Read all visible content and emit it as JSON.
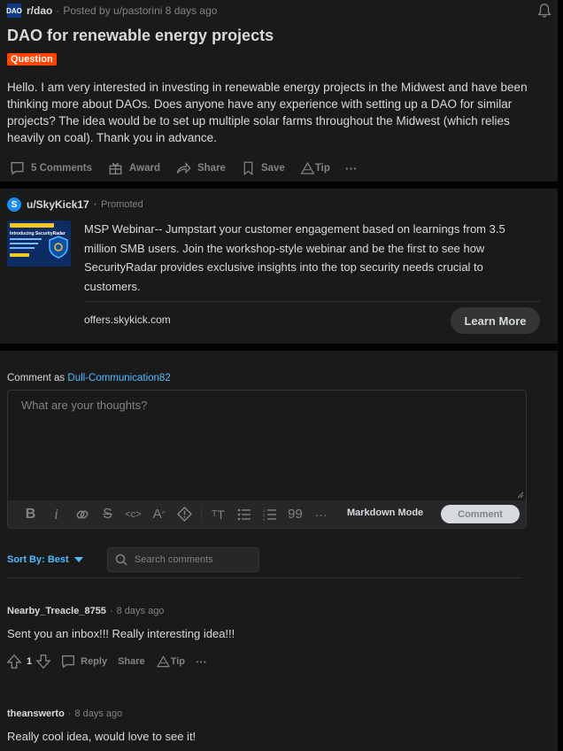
{
  "post": {
    "subreddit": "r/dao",
    "sub_icon_text": "DAO",
    "posted_by": "Posted by u/pastorini 8 days ago",
    "title": "DAO for renewable energy projects",
    "flair": "Question",
    "body": "Hello. I am very interested in investing in renewable energy projects in the Midwest and have been thinking more about DAOs. Does anyone have any experience with setting up a DAO for similar projects? The idea would be to set up multiple solar farms throughout the Midwest (which relies heavily on coal). Thank you in advance.",
    "actions": {
      "comments": "5 Comments",
      "award": "Award",
      "share": "Share",
      "save": "Save",
      "tip": "Tip",
      "more": "···"
    }
  },
  "promo": {
    "user": "u/SkyKick17",
    "icon_letter": "S",
    "label": "Promoted",
    "thumb_title": "Introducing SecurityRadar",
    "text": "MSP Webinar-- Jumpstart your customer engagement based on learnings from 3.5 million SMB users. Join the workshop-style webinar and be the first to see how SecurityRadar provides exclusive insights into the top security needs crucial to customers.",
    "link": "offers.skykick.com",
    "button": "Learn More"
  },
  "composer": {
    "comment_as_prefix": "Comment as",
    "username": "Dull-Communication82",
    "placeholder": "What are your thoughts?",
    "markdown_mode": "Markdown Mode",
    "comment_button": "Comment",
    "toolbar_icons": [
      "bold-icon",
      "italic-icon",
      "link-icon",
      "strikethrough-icon",
      "inline-code-icon",
      "superscript-icon",
      "spoiler-icon",
      "heading-icon",
      "bulleted-list-icon",
      "numbered-list-icon",
      "quote-icon",
      "more-icon"
    ]
  },
  "sort": {
    "label": "Sort By: Best",
    "search_placeholder": "Search comments"
  },
  "comments": [
    {
      "author": "Nearby_Treacle_8755",
      "time": "8 days ago",
      "text": "Sent you an inbox!!! Really interesting idea!!!",
      "score": "1",
      "reply": "Reply",
      "share": "Share",
      "tip": "Tip",
      "more": "···"
    },
    {
      "author": "theanswerto",
      "time": "8 days ago",
      "text": "Really cool idea, would love to see it!"
    }
  ],
  "colors": {
    "background": "#030303",
    "card": "#1a1a1b",
    "accent_blue": "#4fbcff",
    "flair": "#ff4500"
  }
}
